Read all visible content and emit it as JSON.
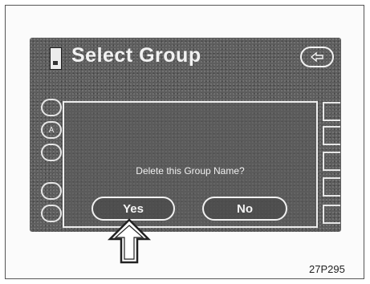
{
  "screen": {
    "title": "Select Group",
    "back_icon": "back-arrow-icon"
  },
  "dialog": {
    "message": "Delete this Group Name?",
    "yes_label": "Yes",
    "no_label": "No"
  },
  "side_left": {
    "labels": [
      "",
      "A",
      "",
      "",
      ""
    ]
  },
  "figure_code": "27P295",
  "colors": {
    "screen_bg": "#5e5e5e",
    "text": "#f2f2f2",
    "frame_border": "#555555"
  }
}
